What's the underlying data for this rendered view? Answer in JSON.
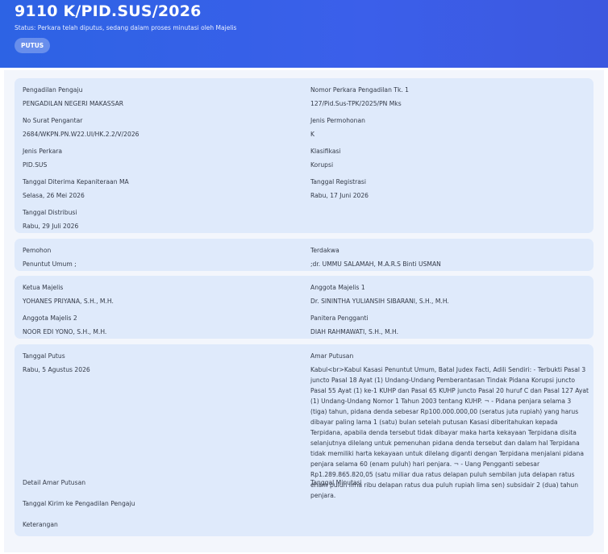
{
  "header": {
    "case_number": "9110 K/PID.SUS/2026",
    "status": "Status: Perkara telah diputus, sedang dalam proses minutasi oleh Majelis",
    "badge": "PUTUS"
  },
  "card1": {
    "pengadilan_label": "Pengadilan Pengaju",
    "pengadilan_value": "PENGADILAN NEGERI MAKASSAR",
    "nomor_label": "Nomor Perkara Pengadilan Tk. 1",
    "nomor_value": "127/Pid.Sus-TPK/2025/PN Mks",
    "surat_label": "No Surat Pengantar",
    "surat_value": "2684/WKPN.PN.W22.UI/HK.2.2/V/2026",
    "permohonan_label": "Jenis Permohonan",
    "permohonan_value": "K",
    "jenis_label": "Jenis Perkara",
    "jenis_value": "PID.SUS",
    "klasifikasi_label": "Klasifikasi",
    "klasifikasi_value": "Korupsi",
    "diterima_label": "Tanggal Diterima Kepaniteraan MA",
    "diterima_value": "Selasa, 26 Mei 2026",
    "registrasi_label": "Tanggal Registrasi",
    "registrasi_value": "Rabu, 17 Juni 2026",
    "distribusi_label": "Tanggal Distribusi",
    "distribusi_value": "Rabu, 29 Juli 2026"
  },
  "card2": {
    "pemohon_label": "Pemohon",
    "pemohon_value": "Penuntut Umum ;",
    "terdakwa_label": "Terdakwa",
    "terdakwa_value": ";dr. UMMU SALAMAH, M.A.R.S Binti USMAN"
  },
  "card3": {
    "ketua_label": "Ketua Majelis",
    "ketua_value": "YOHANES PRIYANA, S.H., M.H.",
    "anggota1_label": "Anggota Majelis 1",
    "anggota1_value": "Dr. SININTHA YULIANSIH SIBARANI, S.H., M.H.",
    "anggota2_label": "Anggota Majelis 2",
    "anggota2_value": "NOOR EDI YONO, S.H., M.H.",
    "panitera_label": "Panitera Pengganti",
    "panitera_value": "DIAH RAHMAWATI, S.H., M.H."
  },
  "card4": {
    "putus_label": "Tanggal Putus",
    "putus_value": "Rabu, 5 Agustus 2026",
    "amar_label": "Amar Putusan",
    "amar_value": "Kabul<br>Kabul Kasasi Penuntut Umum, Batal Judex Facti, Adili Sendiri: - Terbukti Pasal 3 juncto Pasal 18 Ayat (1) Undang-Undang Pemberantasan Tindak Pidana Korupsi juncto Pasal 55 Ayat (1) ke-1 KUHP dan Pasal 65 KUHP juncto Pasal 20 huruf C dan Pasal 127 Ayat (1) Undang-Undang Nomor 1 Tahun 2003 tentang KUHP. ¬ - Pidana penjara selama 3 (tiga) tahun, pidana denda sebesar Rp100.000.000,00 (seratus juta rupiah) yang harus dibayar paling lama 1 (satu) bulan setelah putusan Kasasi diberitahukan kepada Terpidana, apabila denda tersebut tidak dibayar maka harta kekayaan Terpidana disita selanjutnya dilelang untuk pemenuhan pidana denda tersebut dan dalam hal Terpidana tidak memiliki harta kekayaan untuk dilelang diganti dengan Terpidana menjalani pidana penjara selama 60 (enam puluh) hari penjara. ¬ - Uang Pengganti sebesar Rp1.289.865.820,05 (satu miliar dua ratus delapan puluh sembilan juta delapan ratus enam puluh lima ribu delapan ratus dua puluh rupiah lima sen) subsidair 2 (dua) tahun penjara.",
    "detail_label": "Detail Amar Putusan",
    "minutasi_label": "Tanggal Minutasi",
    "kirim_label": "Tanggal Kirim ke Pengadilan Pengaju",
    "keterangan_label": "Keterangan"
  }
}
